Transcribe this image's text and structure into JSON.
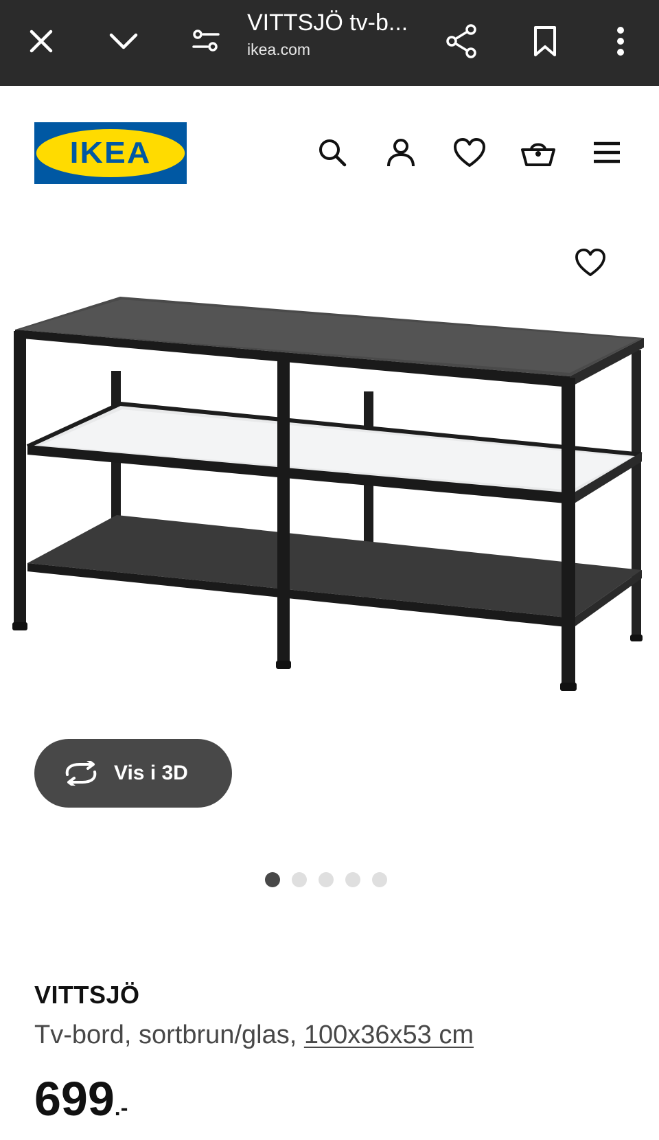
{
  "browser": {
    "title": "VITTSJÖ tv-b...",
    "url": "ikea.com",
    "icons": [
      "close-icon",
      "chevron-down-icon",
      "tune-icon",
      "share-icon",
      "bookmark-icon",
      "more-vert-icon"
    ]
  },
  "header": {
    "logo_text": "IKEA",
    "icons": [
      "search-icon",
      "user-icon",
      "heart-icon",
      "basket-icon",
      "menu-icon"
    ],
    "colors": {
      "logo_blue": "#0058a3",
      "logo_yellow": "#ffdb00"
    }
  },
  "gallery": {
    "view_3d_label": "Vis i 3D",
    "image_count": 5,
    "active_index": 0
  },
  "product": {
    "name": "VITTSJÖ",
    "description": "Tv-bord, sortbrun/glas, ",
    "dimensions": "100x36x53 cm",
    "price": "699",
    "price_suffix": ".-"
  }
}
